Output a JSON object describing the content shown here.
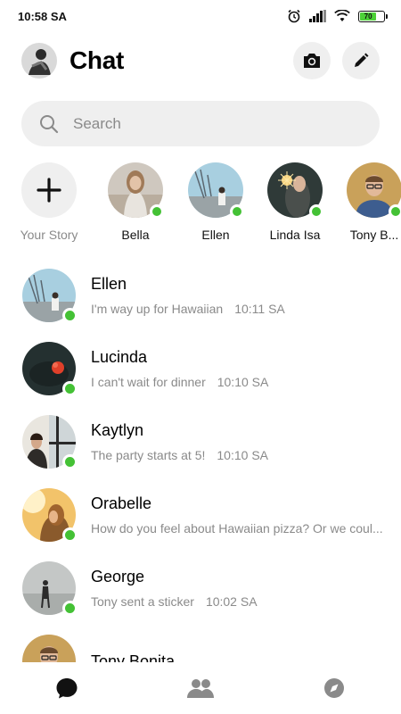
{
  "status_bar": {
    "time": "10:58 SA",
    "battery": "70"
  },
  "header": {
    "title": "Chat",
    "profile_icon": "avatar",
    "camera_icon": "camera-icon",
    "compose_icon": "pencil-icon"
  },
  "search": {
    "placeholder": "Search"
  },
  "stories": [
    {
      "name": "Your Story",
      "type": "add"
    },
    {
      "name": "Bella",
      "online": true
    },
    {
      "name": "Ellen",
      "online": true
    },
    {
      "name": "Linda Isa",
      "online": true
    },
    {
      "name": "Tony B...",
      "online": true
    }
  ],
  "chats": [
    {
      "name": "Ellen",
      "message": "I'm way up for Hawaiian",
      "time": "10:11 SA",
      "online": true
    },
    {
      "name": "Lucinda",
      "message": "I can't wait for dinner",
      "time": "10:10 SA",
      "online": true
    },
    {
      "name": "Kaytlyn",
      "message": "The party starts at 5!",
      "time": "10:10 SA",
      "online": true
    },
    {
      "name": "Orabelle",
      "message": "How do you feel about Hawaiian pizza? Or we coul...",
      "time": "",
      "online": true
    },
    {
      "name": "George",
      "message": "Tony sent a sticker",
      "time": "10:02 SA",
      "online": true
    },
    {
      "name": "Tony Bonita",
      "message": "",
      "time": "",
      "online": false
    }
  ],
  "nav": {
    "chats_icon": "chat-bubble-icon",
    "people_icon": "people-icon",
    "discover_icon": "compass-icon"
  },
  "colors": {
    "online": "#44c135",
    "pill_bg": "#efefef",
    "muted_text": "#8a8a8a"
  }
}
